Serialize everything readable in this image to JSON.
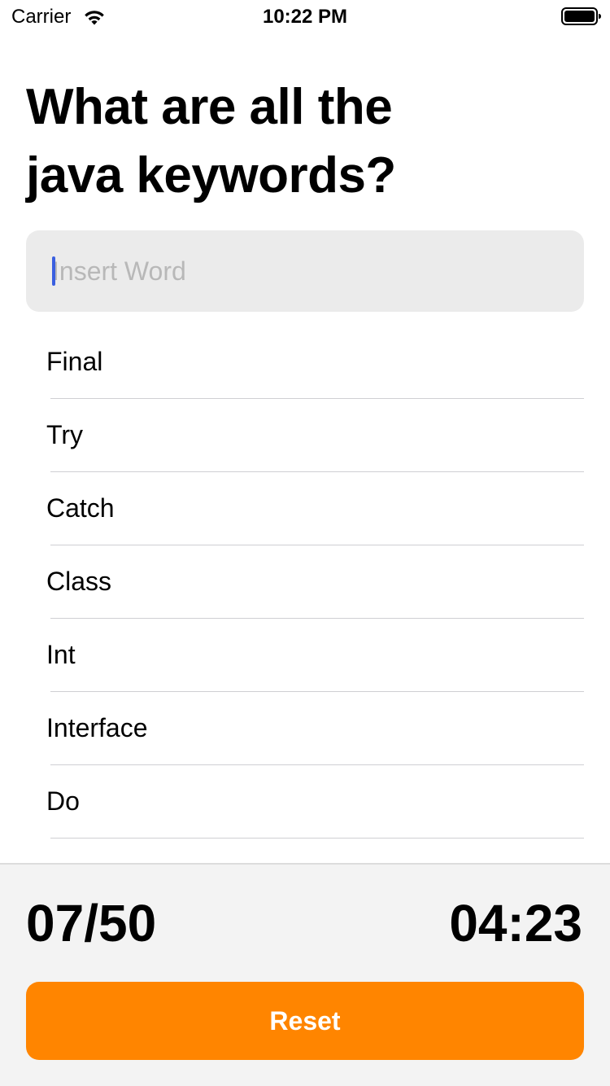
{
  "status_bar": {
    "carrier": "Carrier",
    "time": "10:22 PM",
    "wifi_icon": "wifi-icon",
    "battery_icon": "battery-full-icon"
  },
  "quiz": {
    "question_line1": "What are all the",
    "question_line2": "java keywords?"
  },
  "input": {
    "placeholder": "Insert Word",
    "value": ""
  },
  "answers": [
    "Final",
    "Try",
    "Catch",
    "Class",
    "Int",
    "Interface",
    "Do"
  ],
  "footer": {
    "score": "07/50",
    "timer": "04:23",
    "reset_label": "Reset"
  },
  "colors": {
    "accent": "#ff8500",
    "input_background": "#ebebeb",
    "panel_background": "#f3f3f3",
    "placeholder": "#b8b8b8",
    "cursor": "#3a5fe0"
  }
}
